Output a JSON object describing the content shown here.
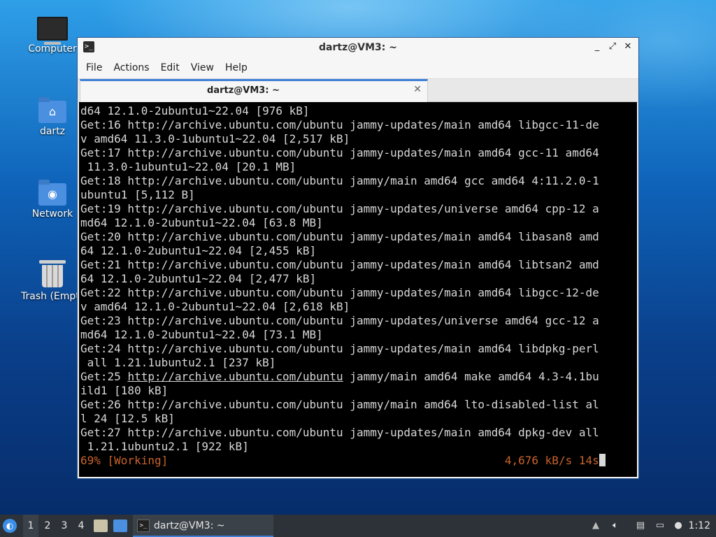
{
  "desktop": {
    "icons": [
      {
        "label": "Computer"
      },
      {
        "label": "dartz"
      },
      {
        "label": "Network"
      },
      {
        "label": "Trash (Empty)"
      }
    ]
  },
  "window": {
    "title": "dartz@VM3: ~",
    "menu": [
      "File",
      "Actions",
      "Edit",
      "View",
      "Help"
    ],
    "tab_label": "dartz@VM3: ~",
    "controls": {
      "minimize": "_",
      "maximize": "⤢",
      "close": "✕"
    }
  },
  "terminal": {
    "lines": [
      "d64 12.1.0-2ubuntu1~22.04 [976 kB]",
      "Get:16 http://archive.ubuntu.com/ubuntu jammy-updates/main amd64 libgcc-11-de",
      "v amd64 11.3.0-1ubuntu1~22.04 [2,517 kB]",
      "Get:17 http://archive.ubuntu.com/ubuntu jammy-updates/main amd64 gcc-11 amd64",
      " 11.3.0-1ubuntu1~22.04 [20.1 MB]",
      "Get:18 http://archive.ubuntu.com/ubuntu jammy/main amd64 gcc amd64 4:11.2.0-1",
      "ubuntu1 [5,112 B]",
      "Get:19 http://archive.ubuntu.com/ubuntu jammy-updates/universe amd64 cpp-12 a",
      "md64 12.1.0-2ubuntu1~22.04 [63.8 MB]",
      "Get:20 http://archive.ubuntu.com/ubuntu jammy-updates/main amd64 libasan8 amd",
      "64 12.1.0-2ubuntu1~22.04 [2,455 kB]",
      "Get:21 http://archive.ubuntu.com/ubuntu jammy-updates/main amd64 libtsan2 amd",
      "64 12.1.0-2ubuntu1~22.04 [2,477 kB]",
      "Get:22 http://archive.ubuntu.com/ubuntu jammy-updates/main amd64 libgcc-12-de",
      "v amd64 12.1.0-2ubuntu1~22.04 [2,618 kB]",
      "Get:23 http://archive.ubuntu.com/ubuntu jammy-updates/universe amd64 gcc-12 a",
      "md64 12.1.0-2ubuntu1~22.04 [73.1 MB]",
      "Get:24 http://archive.ubuntu.com/ubuntu jammy-updates/main amd64 libdpkg-perl",
      " all 1.21.1ubuntu2.1 [237 kB]"
    ],
    "line25_prefix": "Get:25 ",
    "line25_link": "http://archive.ubuntu.com/ubuntu",
    "line25_suffix": " jammy/main amd64 make amd64 4.3-4.1bu",
    "lines_after": [
      "ild1 [180 kB]",
      "Get:26 http://archive.ubuntu.com/ubuntu jammy/main amd64 lto-disabled-list al",
      "l 24 [12.5 kB]",
      "Get:27 http://archive.ubuntu.com/ubuntu jammy-updates/main amd64 dpkg-dev all",
      " 1.21.1ubuntu2.1 [922 kB]"
    ],
    "status_left": "69% [Working]",
    "status_right": "4,676 kB/s 14s"
  },
  "taskbar": {
    "workspaces": [
      "1",
      "2",
      "3",
      "4"
    ],
    "active_workspace": "1",
    "task_label": "dartz@VM3: ~",
    "clock": "1:12"
  },
  "colors": {
    "accent": "#3d7fd6",
    "terminal_bg": "#000000",
    "status_text": "#c9642a"
  }
}
